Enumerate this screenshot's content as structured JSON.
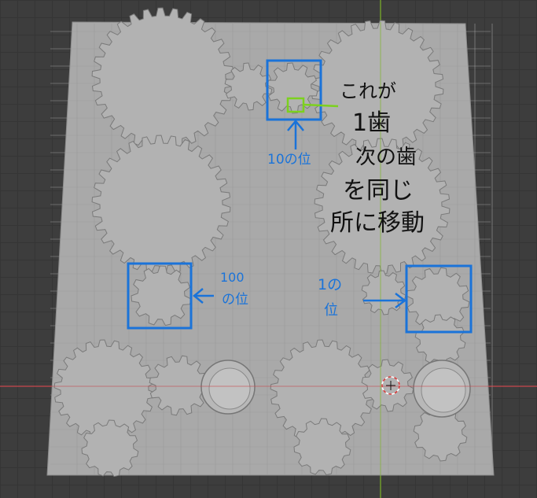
{
  "viewport": {
    "colors": {
      "grid_bg": "#3d3d3d",
      "plate": "#a9a9a9",
      "gear": "#b2b2b2",
      "gear_edge": "#7a7a7a",
      "x_axis": "#c8474d",
      "y_axis": "#7fb52a",
      "annotation_blue": "#1a73d9",
      "annotation_green": "#7cd11e",
      "annotation_black": "#111111"
    },
    "cursor_icon": "3d-cursor-icon"
  },
  "annotations": {
    "tens": {
      "label_1": "10の位"
    },
    "hundreds": {
      "label_1": "100",
      "label_2": "の位"
    },
    "ones": {
      "label_1": "1の",
      "label_2": "位"
    },
    "note": {
      "line1": "これが",
      "line2": "1歯",
      "line3": "次の歯",
      "line4": "を同じ",
      "line5": "所に移動"
    }
  }
}
